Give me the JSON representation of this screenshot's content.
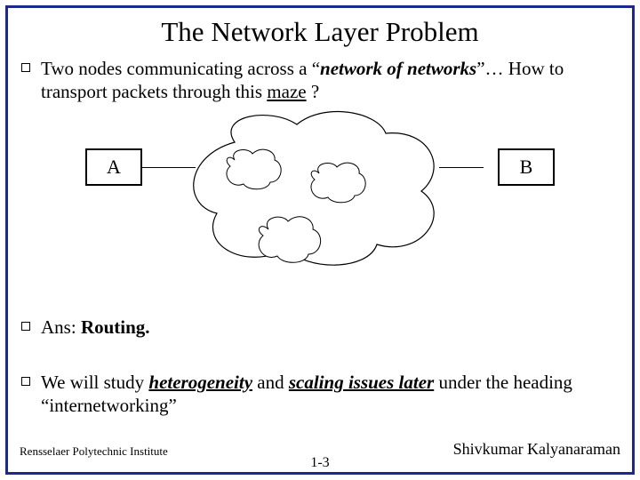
{
  "title": "The Network Layer Problem",
  "bullets": [
    {
      "prefix": "Two nodes communicating across a “",
      "em1": "network of networks",
      "mid": "”… How to transport packets through this ",
      "u1": "maze",
      "suffix": " ?"
    },
    {
      "prefix": "Ans: ",
      "bold1": "Routing."
    },
    {
      "prefix": "We will study ",
      "bu1": "heterogeneity",
      "mid1": " and ",
      "bu2": "scaling issues later",
      "mid2": " under the heading “internetworking”"
    }
  ],
  "nodes": {
    "a": "A",
    "b": "B"
  },
  "footer": {
    "left": "Rensselaer Polytechnic Institute",
    "right": "Shivkumar Kalyanaraman",
    "page": "1-3"
  }
}
